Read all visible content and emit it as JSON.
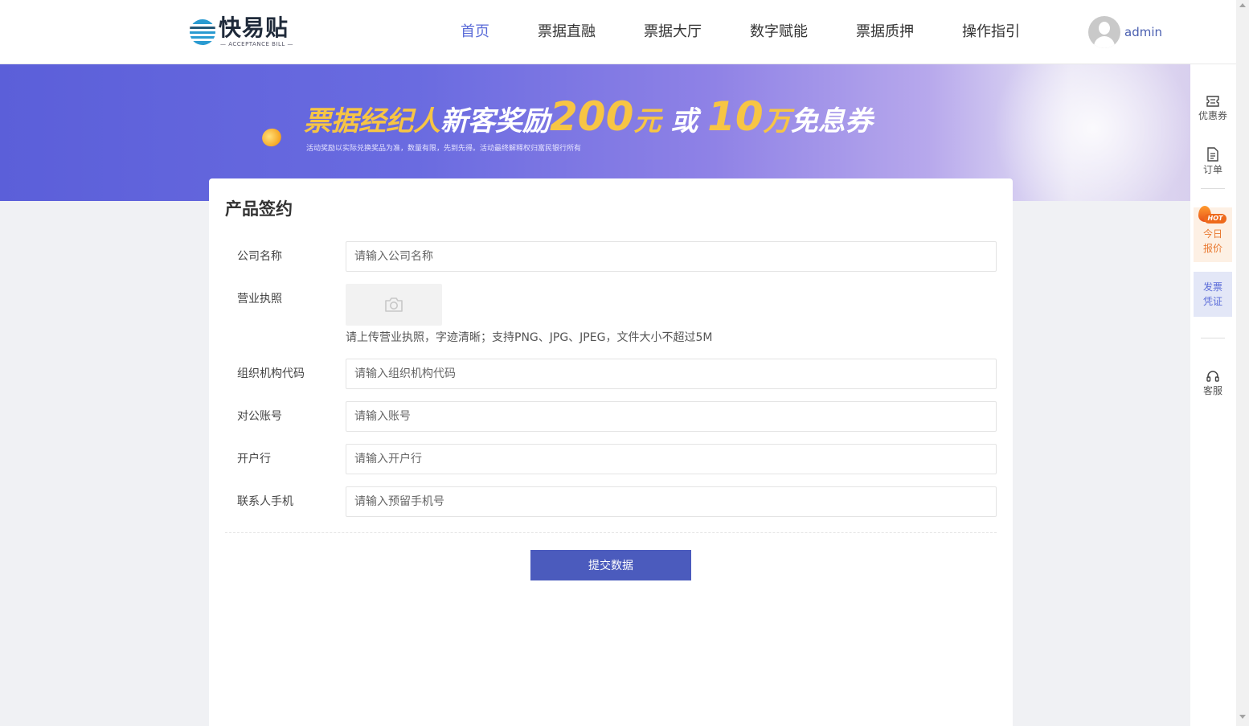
{
  "header": {
    "logo_text": "快易贴",
    "logo_subtitle": "— ACCEPTANCE BILL —",
    "nav": [
      {
        "label": "首页",
        "active": true
      },
      {
        "label": "票据直融",
        "active": false
      },
      {
        "label": "票据大厅",
        "active": false
      },
      {
        "label": "数字赋能",
        "active": false
      },
      {
        "label": "票据质押",
        "active": false
      },
      {
        "label": "操作指引",
        "active": false
      }
    ],
    "username": "admin"
  },
  "banner": {
    "title_part1": "票据经纪人",
    "title_part2": "新客奖励",
    "title_amount1": "200",
    "title_unit1": "元",
    "title_or": " 或 ",
    "title_amount2": "10",
    "title_unit2": "万",
    "title_part3": "免息券",
    "note": "活动奖励以实际兑换奖品为准，数量有限，先到先得。活动最终解释权归富民银行所有"
  },
  "form": {
    "title": "产品签约",
    "fields": [
      {
        "label": "公司名称",
        "placeholder": "请输入公司名称",
        "value": ""
      },
      {
        "label": "营业执照"
      },
      {
        "label": "组织机构代码",
        "placeholder": "请输入组织机构代码",
        "value": ""
      },
      {
        "label": "对公账号",
        "placeholder": "请输入账号",
        "value": ""
      },
      {
        "label": "开户行",
        "placeholder": "请输入开户行",
        "value": ""
      },
      {
        "label": "联系人手机",
        "placeholder": "请输入预留手机号",
        "value": ""
      }
    ],
    "upload_hint": "请上传营业执照，字迹清晰；支持PNG、JPG、JPEG，文件大小不超过5M",
    "submit_label": "提交数据"
  },
  "sidebar": {
    "coupon_label": "优惠券",
    "order_label": "订单",
    "hot_badge": "HOT",
    "hot_label_line1": "今日",
    "hot_label_line2": "报价",
    "invoice_line1": "发票",
    "invoice_line2": "凭证",
    "service_label": "客服"
  },
  "colors": {
    "accent": "#5a6bd8",
    "submit_button": "#4b5bbd",
    "banner_gold": "#f7c544",
    "hot_orange": "#ee6a1c"
  }
}
